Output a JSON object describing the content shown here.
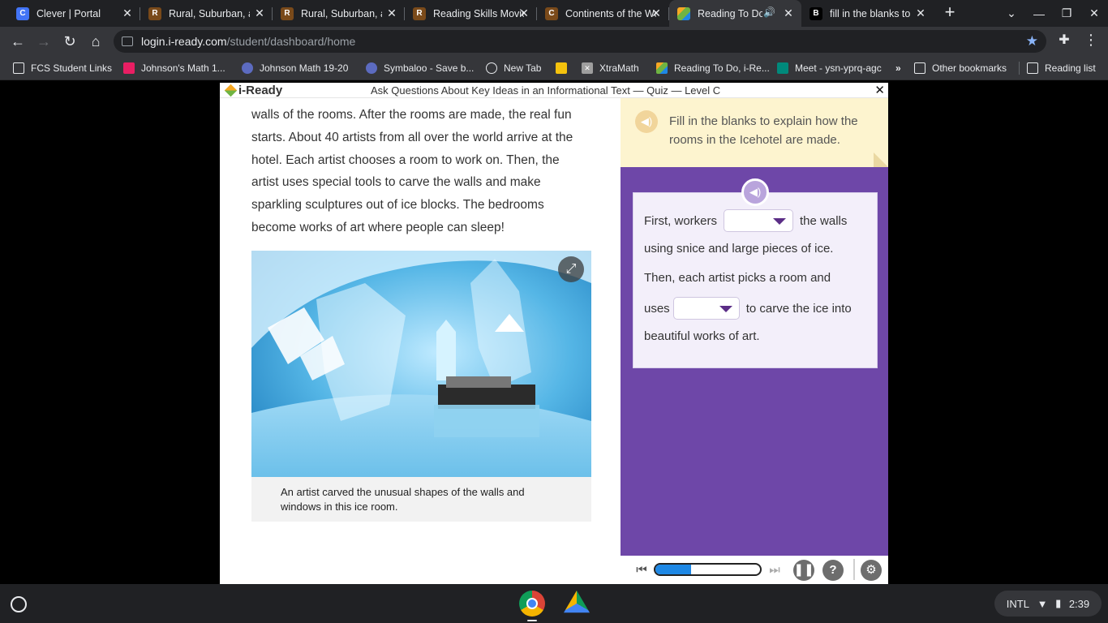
{
  "tabs": [
    {
      "title": "Clever | Portal",
      "icon": "clever-icon",
      "color": "#4274f6",
      "letter": "C"
    },
    {
      "title": "Rural, Suburban, and Urban",
      "icon": "rural-icon",
      "color": "#7a4a1a",
      "letter": "R"
    },
    {
      "title": "Rural, Suburban, and Urban",
      "icon": "rural-icon",
      "color": "#7a4a1a",
      "letter": "R"
    },
    {
      "title": "Reading Skills Movie",
      "icon": "reading-skills-icon",
      "color": "#7a4a1a",
      "letter": "R"
    },
    {
      "title": "Continents of the World",
      "icon": "continents-icon",
      "color": "#7a4a1a",
      "letter": "C"
    },
    {
      "title": "Reading To Do",
      "icon": "iready-icon",
      "color": "#6fb442",
      "letter": "",
      "active": true
    },
    {
      "title": "fill in the blanks to explain",
      "icon": "brainly-icon",
      "color": "#000000",
      "letter": "B"
    }
  ],
  "url": {
    "host": "login.i-ready.com",
    "path": "/student/dashboard/home"
  },
  "bookmarks": [
    {
      "label": "FCS Student Links",
      "icon": "folder-icon",
      "color": "#e8eaed"
    },
    {
      "label": "Johnson's Math 1...",
      "icon": "classroom-icon",
      "color": "#e91e63"
    },
    {
      "label": "Johnson Math 19-20",
      "icon": "symbaloo-icon",
      "color": "#5c6bc0"
    },
    {
      "label": "Symbaloo - Save b...",
      "icon": "symbaloo-icon",
      "color": "#5c6bc0"
    },
    {
      "label": "New Tab",
      "icon": "globe-icon",
      "color": "#e8eaed"
    },
    {
      "label": "",
      "icon": "app-icon",
      "color": "#f4c20d"
    },
    {
      "label": "XtraMath",
      "icon": "xtramath-icon",
      "color": "#9e9e9e"
    },
    {
      "label": "Reading To Do, i-Re...",
      "icon": "iready-icon",
      "color": "#6fb442"
    },
    {
      "label": "Meet - ysn-yprq-agc",
      "icon": "meet-icon",
      "color": "#00897b"
    },
    {
      "label": "»",
      "icon": "more-bookmarks-icon",
      "color": "#35363a"
    },
    {
      "label": "Other bookmarks",
      "icon": "folder-icon",
      "color": "#e8eaed"
    },
    {
      "label": "Reading list",
      "icon": "reading-list-icon",
      "color": "#e8eaed"
    }
  ],
  "iready": {
    "logo": "i-Ready",
    "title": "Ask Questions About Key Ideas in an Informational Text — Quiz — Level C",
    "close": "✕"
  },
  "passage": {
    "lines": [
      "walls of the rooms. After the rooms are made, the real fun",
      "starts. About 40 artists from all over the world arrive at the",
      "hotel. Each artist chooses a room to work on. Then, the",
      "artist uses special tools to carve the walls and make",
      "sparkling sculptures out of ice blocks. The bedrooms",
      "become works of art where people can sleep!"
    ],
    "caption_line1": "An artist carved the unusual shapes of the walls and",
    "caption_line2": "windows in this ice room."
  },
  "question": {
    "prompt": "Fill in the blanks to explain how the rooms in the Icehotel are made.",
    "line1_pre": "First, workers",
    "line1_post": "the walls",
    "line2": "using snice and large pieces of ice.",
    "line3": "Then, each artist picks a room and",
    "line4_pre": "uses",
    "line4_post": "to carve the ice into",
    "line5": "beautiful works of art.",
    "dropdown1_value": "",
    "dropdown2_value": ""
  },
  "player": {
    "progress_fraction": 0.34
  },
  "shelf": {
    "tray_lang": "INTL",
    "time": "2:39"
  }
}
